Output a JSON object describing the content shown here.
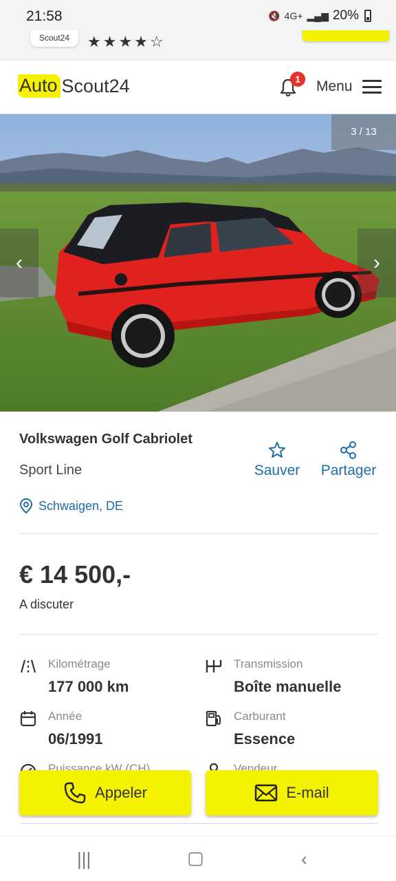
{
  "status_bar": {
    "time": "21:58",
    "network": "4G+",
    "battery": "20%"
  },
  "app_banner": {
    "app_name": "Scout24",
    "rating_stars": "★★★★☆"
  },
  "header": {
    "logo_part1": "Auto",
    "logo_part2": "Scout24",
    "notifications_count": "1",
    "menu_label": "Menu"
  },
  "gallery": {
    "counter": "3 / 13",
    "prev_icon": "chevron-left-icon",
    "next_icon": "chevron-right-icon"
  },
  "listing": {
    "title": "Volkswagen Golf Cabriolet",
    "subtitle": "Sport Line",
    "location": "Schwaigen, DE",
    "save_label": "Sauver",
    "share_label": "Partager",
    "price": "€ 14 500,-",
    "price_note": "A discuter"
  },
  "specs": [
    {
      "label": "Kilométrage",
      "value": "177 000 km",
      "icon": "road-icon"
    },
    {
      "label": "Transmission",
      "value": "Boîte manuelle",
      "icon": "gearshift-icon"
    },
    {
      "label": "Année",
      "value": "06/1991",
      "icon": "calendar-icon"
    },
    {
      "label": "Carburant",
      "value": "Essence",
      "icon": "fuel-pump-icon"
    },
    {
      "label": "Puissance kW (CH)",
      "value": "",
      "icon": "speedometer-icon"
    },
    {
      "label": "Vendeur",
      "value": "",
      "icon": "person-icon"
    }
  ],
  "actions": {
    "call_label": "Appeler",
    "email_label": "E-mail"
  },
  "colors": {
    "brand_yellow": "#f5f200",
    "link_blue": "#1c6da8",
    "badge_red": "#e4332c"
  }
}
